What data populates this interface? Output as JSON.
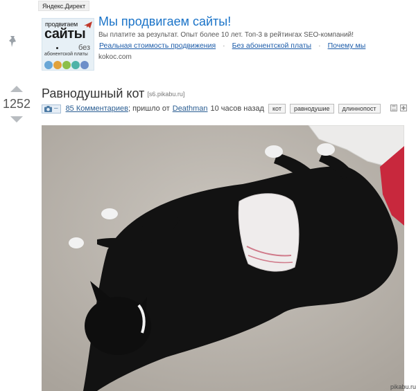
{
  "ad": {
    "label": "Яндекс.Директ",
    "logo": {
      "line1": "продвигаем",
      "line2": "сайты",
      "line3": "без",
      "line4": "абонентской платы"
    },
    "title": "Мы продвигаем сайты!",
    "text": "Вы платите за результат. Опыт более 10 лет. Топ-3 в рейтингах SEO-компаний!",
    "links": [
      "Реальная стоимость продвижения",
      "Без абонентской платы",
      "Почему мы"
    ],
    "separator": "·",
    "domain": "kokoc.com"
  },
  "story": {
    "rating": "1252",
    "title": "Равнодушный кот",
    "source": "[s6.pikabu.ru]",
    "photo_badge_dash": "–",
    "comments_link": "85 Комментариев",
    "posted_from": "; пришло от",
    "author": "Deathman",
    "time_ago": "10 часов назад",
    "tags": [
      "кот",
      "равнодушие",
      "длиннопост"
    ],
    "watermark": "pikabu.ru"
  },
  "colors": {
    "ad_title": "#1a73c8",
    "link": "#2a5d92",
    "carpet": "#bcb6ae"
  },
  "icons": {
    "pin": "pin-icon",
    "vote_up": "arrow-up-icon",
    "vote_down": "arrow-down-icon",
    "photo": "camera-icon",
    "save": "save-icon",
    "expand": "plus-icon"
  }
}
